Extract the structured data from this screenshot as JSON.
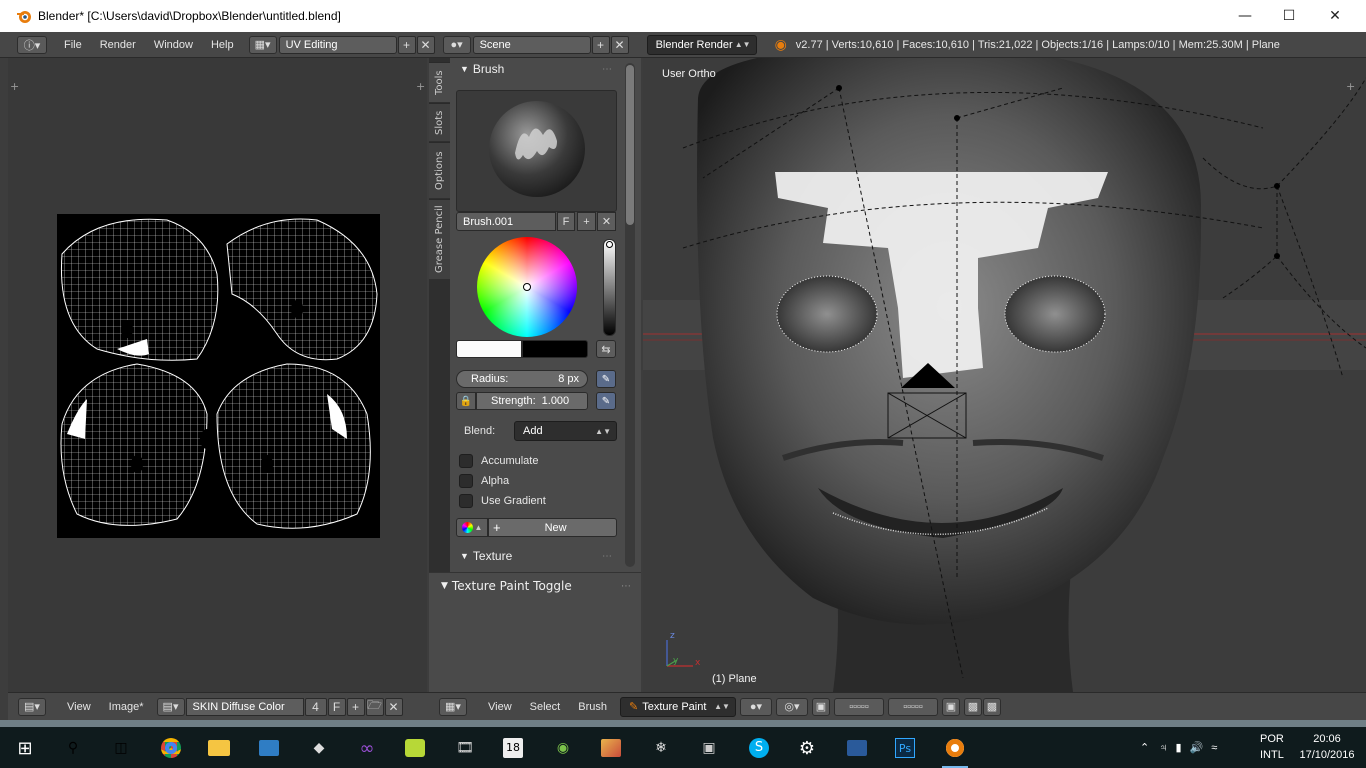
{
  "window": {
    "title": "Blender* [C:\\Users\\david\\Dropbox\\Blender\\untitled.blend]",
    "controls": [
      "minimize-icon",
      "maximize-icon",
      "close-icon"
    ]
  },
  "topbar": {
    "menus": [
      "File",
      "Render",
      "Window",
      "Help"
    ],
    "layout": "UV Editing",
    "scene": "Scene",
    "engine": "Blender Render",
    "stats": "v2.77 | Verts:10,610 | Faces:10,610 | Tris:21,022 | Objects:1/16 | Lamps:0/10 | Mem:25.30M | Plane"
  },
  "toolshelf": {
    "tabs": [
      "Tools",
      "Slots",
      "Options",
      "Grease Pencil"
    ],
    "brush_panel": "Brush",
    "brush_name": "Brush.001",
    "fake_user": "F",
    "radius_label": "Radius:",
    "radius_value": "8 px",
    "strength_label": "Strength:",
    "strength_value": "1.000",
    "blend_label": "Blend:",
    "blend_value": "Add",
    "checkboxes": [
      "Accumulate",
      "Alpha",
      "Use Gradient"
    ],
    "new_label": "New",
    "texture_panel": "Texture",
    "texture_paint_toggle": "Texture Paint Toggle"
  },
  "viewport": {
    "view_label": "User Ortho",
    "object_label": "(1) Plane",
    "axes": {
      "z": "z",
      "y": "y",
      "x": "x"
    }
  },
  "uv_footer": {
    "menus": [
      "View",
      "Image*"
    ],
    "image_name": "SKIN Diffuse Color",
    "users": "4",
    "fake_user": "F"
  },
  "view3d_footer": {
    "menus": [
      "View",
      "Select",
      "Brush"
    ],
    "mode": "Texture Paint"
  },
  "taskbar": {
    "apps": [
      "windows-start-icon",
      "search-icon",
      "task-view-icon",
      "chrome-icon",
      "file-explorer-icon",
      "contacts-icon",
      "unity-icon",
      "visual-studio-icon",
      "toad-icon",
      "movie-icon",
      "calendar-18-icon",
      "android-icon",
      "paint-icon",
      "app-icon",
      "monitor-icon",
      "skype-icon",
      "settings-icon",
      "media-icon",
      "photoshop-icon",
      "blender-icon"
    ],
    "lang": "POR",
    "layout": "INTL",
    "time": "20:06",
    "date": "17/10/2016"
  }
}
